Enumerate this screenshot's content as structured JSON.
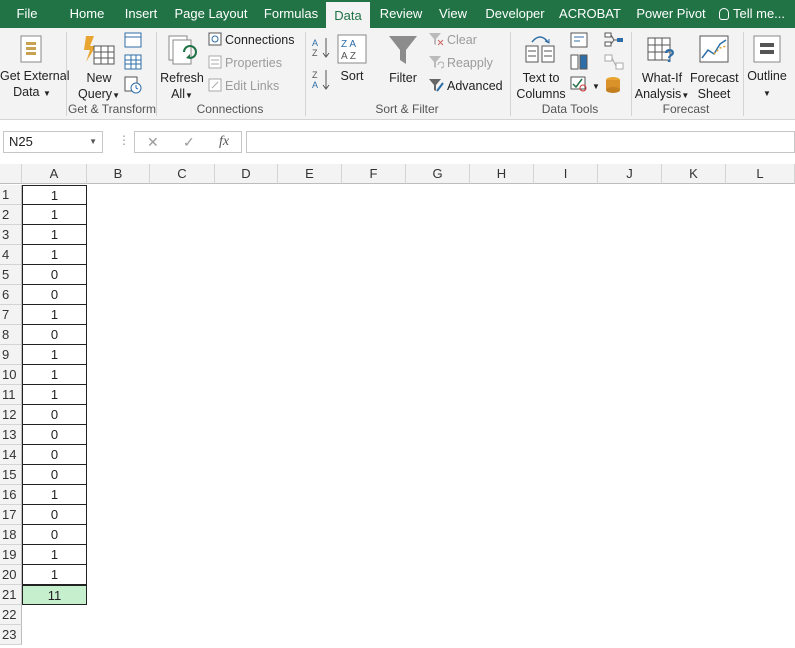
{
  "tabs": [
    "File",
    "Home",
    "Insert",
    "Page Layout",
    "Formulas",
    "Data",
    "Review",
    "View",
    "Developer",
    "ACROBAT",
    "Power Pivot",
    "Tell me..."
  ],
  "active_tab": "Data",
  "ribbon": {
    "get_external": {
      "line1": "Get External",
      "line2": "Data"
    },
    "new_query": {
      "line1": "New",
      "line2": "Query"
    },
    "group_get_transform": "Get & Transform",
    "refresh": {
      "line1": "Refresh",
      "line2": "All"
    },
    "connections": "Connections",
    "properties": "Properties",
    "edit_links": "Edit Links",
    "group_connections": "Connections",
    "sort": "Sort",
    "filter": "Filter",
    "clear": "Clear",
    "reapply": "Reapply",
    "advanced": "Advanced",
    "group_sort_filter": "Sort & Filter",
    "text_to_columns": {
      "line1": "Text to",
      "line2": "Columns"
    },
    "group_data_tools": "Data Tools",
    "what_if": {
      "line1": "What-If",
      "line2": "Analysis"
    },
    "forecast_sheet": {
      "line1": "Forecast",
      "line2": "Sheet"
    },
    "group_forecast": "Forecast",
    "outline": "Outline"
  },
  "formula_bar": {
    "name_box": "N25",
    "fx": "fx",
    "formula": ""
  },
  "columns": [
    "A",
    "B",
    "C",
    "D",
    "E",
    "F",
    "G",
    "H",
    "I",
    "J",
    "K",
    "L"
  ],
  "rows": [
    "1",
    "2",
    "3",
    "4",
    "5",
    "6",
    "7",
    "8",
    "9",
    "10",
    "11",
    "12",
    "13",
    "14",
    "15",
    "16",
    "17",
    "18",
    "19",
    "20",
    "21",
    "22",
    "23"
  ],
  "column_a_values": [
    "1",
    "1",
    "1",
    "1",
    "0",
    "0",
    "1",
    "0",
    "1",
    "1",
    "1",
    "0",
    "0",
    "0",
    "0",
    "1",
    "0",
    "0",
    "1",
    "1",
    "11"
  ],
  "colors": {
    "excel_green": "#217346",
    "total_cell": "#c6efce"
  }
}
